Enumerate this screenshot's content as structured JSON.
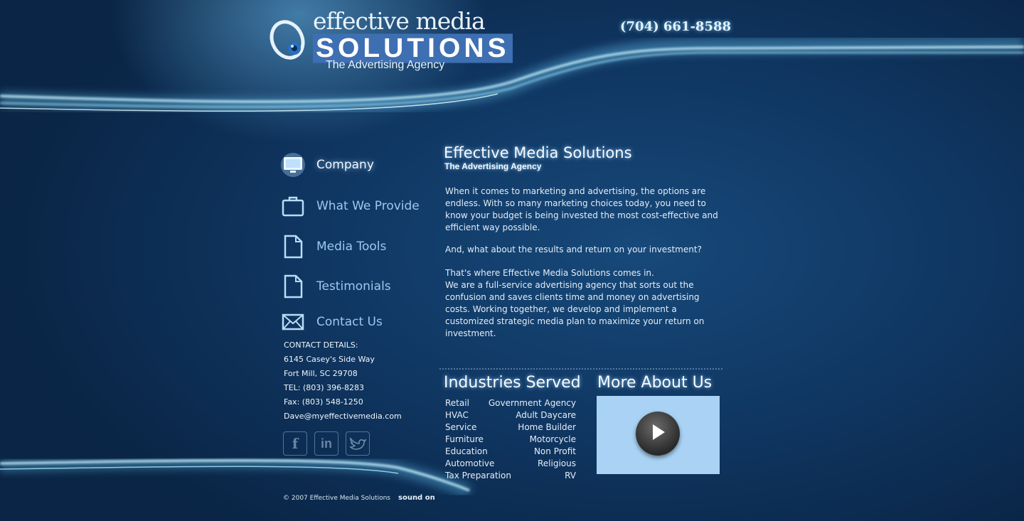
{
  "header": {
    "logo_line1": "effective media",
    "logo_line2": "SOLUTIONS",
    "logo_line3": "The Advertising Agency",
    "phone": "(704) 661-8588"
  },
  "nav": {
    "items": [
      {
        "label": "Company",
        "icon": "monitor-icon",
        "active": true
      },
      {
        "label": "What We Provide",
        "icon": "briefcase-icon"
      },
      {
        "label": "Media Tools",
        "icon": "document-icon"
      },
      {
        "label": "Testimonials",
        "icon": "document-icon"
      },
      {
        "label": "Contact Us",
        "icon": "envelope-icon"
      }
    ]
  },
  "contact": {
    "heading": "CONTACT DETAILS:",
    "street": "6145 Casey's Side Way",
    "city": "Fort Mill, SC 29708",
    "tel": "TEL: (803) 396-8283",
    "fax": "Fax: (803) 548-1250",
    "email": "Dave@myeffectivemedia.com"
  },
  "social": {
    "facebook": "f",
    "linkedin": "in",
    "twitter": "twitter-bird-icon"
  },
  "main": {
    "title": "Effective Media Solutions",
    "subtitle": "The Advertising Agency",
    "para1": "When it comes to marketing and advertising, the options are endless. With so many marketing choices today, you need to know your budget is being invested the most cost-effective and efficient way possible.",
    "para2": "And, what about the results and return on your investment?",
    "para3_line1": "That's where Effective Media Solutions comes in.",
    "para3_line2": "We are a full-service advertising agency that sorts out the confusion and saves clients time and money on advertising costs. Working together, we develop and implement a customized strategic media plan to maximize your return on investment."
  },
  "industries": {
    "title": "Industries Served",
    "left": [
      "Retail",
      "HVAC",
      "Service",
      "Furniture",
      "Education",
      "Automotive",
      "Tax Preparation"
    ],
    "right": [
      "Government Agency",
      "Adult Daycare",
      "Home Builder",
      "Motorcycle",
      "Non Profit",
      "Religious",
      "RV"
    ]
  },
  "about": {
    "title": "More About Us"
  },
  "footer": {
    "copyright": "© 2007 Effective Media Solutions",
    "sound": "sound on"
  },
  "colors": {
    "background": "#0f3560",
    "glow": "#9fe8ff",
    "nav_text": "#9ec8ee",
    "video_bg": "#a9d2f4"
  }
}
